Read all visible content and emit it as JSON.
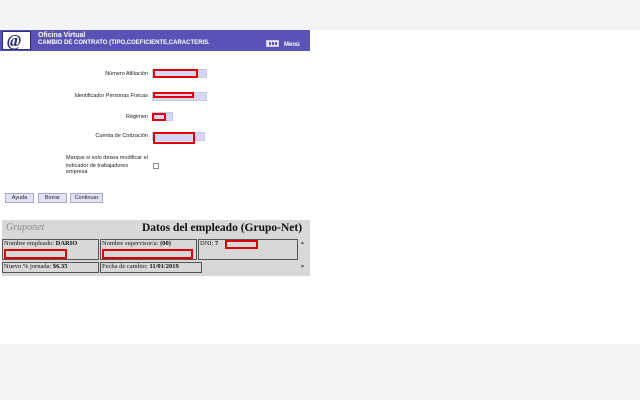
{
  "header": {
    "logo_text": "@",
    "title": "Oficina Virtual",
    "subtitle": "CAMBIO DE CONTRATO (TIPO,COEFICIENTE,CARACTERIS.",
    "menu_label": "Menú",
    "bg_color": "#5a52b6"
  },
  "form": {
    "afiliacion_label": "Número Afiliación",
    "ipf_label": "Identificador Personas Físicas",
    "regimen_label": "Régimen",
    "cotizacion_label": "Cuenta de Cotización",
    "checkbox_label_line1": "Marque si solo desea modificar el",
    "checkbox_label_line2": "indicador de trabajadores empresa",
    "checkbox_checked": false,
    "redaction_color": "#e00000"
  },
  "buttons": {
    "ayuda": "Ayuda",
    "borrar": "Borrar",
    "continuar": "Continuar"
  },
  "employee": {
    "logo": "Gruponet",
    "title": "Datos del empleado (Grupo-Net)",
    "nombre_empleado_label": "Nombre empleado:",
    "nombre_empleado_value": "DARIO",
    "supervisor_label": "Nombre supervisor/a:",
    "supervisor_value": "(00)",
    "dni_label": "DNI:",
    "dni_value": "7",
    "jornada_label": "Nuevo % jornada:",
    "jornada_value": "$6.35",
    "fecha_label": "Fecha de cambio:",
    "fecha_value": "11/01/2019"
  }
}
